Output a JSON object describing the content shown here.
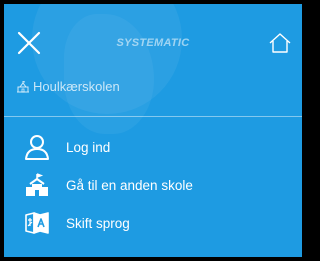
{
  "header": {
    "brand": "SYSTEMATIC",
    "close_icon": "close-icon",
    "home_icon": "home-icon"
  },
  "school": {
    "icon": "school-icon",
    "name": "Houlkærskolen"
  },
  "menu": {
    "items": [
      {
        "label": "Log ind",
        "icon": "user-icon"
      },
      {
        "label": "Gå til en anden skole",
        "icon": "school-icon"
      },
      {
        "label": "Skift sprog",
        "icon": "translate-icon"
      }
    ]
  },
  "colors": {
    "background": "#1e9be2",
    "text": "#ffffff",
    "frame": "#000000"
  }
}
